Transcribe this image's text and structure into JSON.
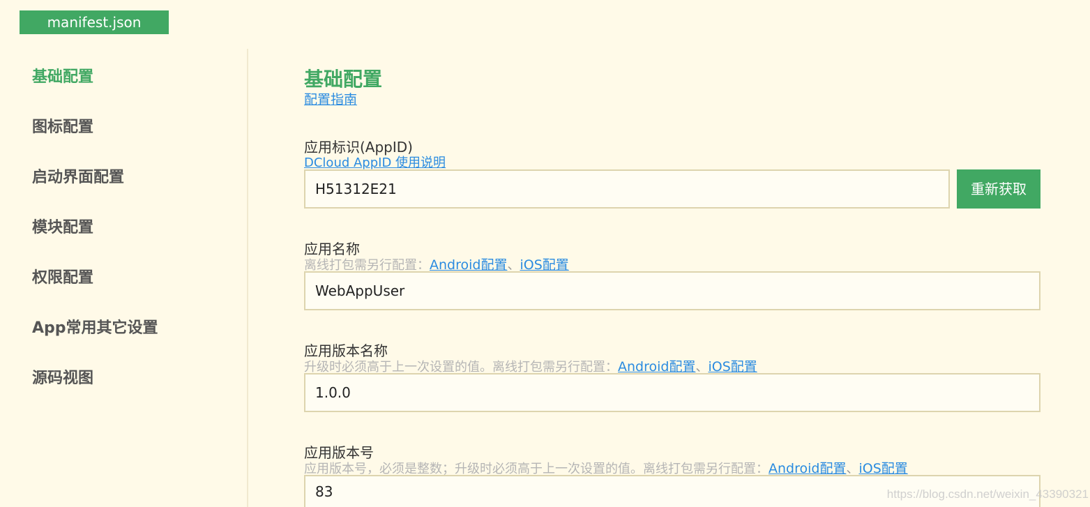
{
  "tab": {
    "label": "manifest.json"
  },
  "sidebar": {
    "items": [
      {
        "label": "基础配置"
      },
      {
        "label": "图标配置"
      },
      {
        "label": "启动界面配置"
      },
      {
        "label": "模块配置"
      },
      {
        "label": "权限配置"
      },
      {
        "label": "App常用其它设置"
      },
      {
        "label": "源码视图"
      }
    ]
  },
  "main": {
    "title": "基础配置",
    "guide_link": "配置指南",
    "appid": {
      "label": "应用标识(AppID)",
      "help_link": "DCloud AppID 使用说明",
      "value": "H51312E21",
      "button": "重新获取"
    },
    "app_name": {
      "label": "应用名称",
      "hint": "离线打包需另行配置：",
      "android_link": "Android配置",
      "separator": "、",
      "ios_link": "iOS配置",
      "value": "WebAppUser"
    },
    "version_name": {
      "label": "应用版本名称",
      "hint": "升级时必须高于上一次设置的值。离线打包需另行配置：",
      "android_link": "Android配置",
      "separator": "、",
      "ios_link": "iOS配置",
      "value": "1.0.0"
    },
    "version_code": {
      "label": "应用版本号",
      "hint": "应用版本号，必须是整数；升级时必须高于上一次设置的值。离线打包需另行配置：",
      "android_link": "Android配置",
      "separator": "、",
      "ios_link": "iOS配置",
      "value": "83"
    }
  },
  "watermark": "https://blog.csdn.net/weixin_43390321",
  "colors": {
    "accent": "#41a863",
    "background": "#fffae8",
    "link": "#2a8be0"
  }
}
